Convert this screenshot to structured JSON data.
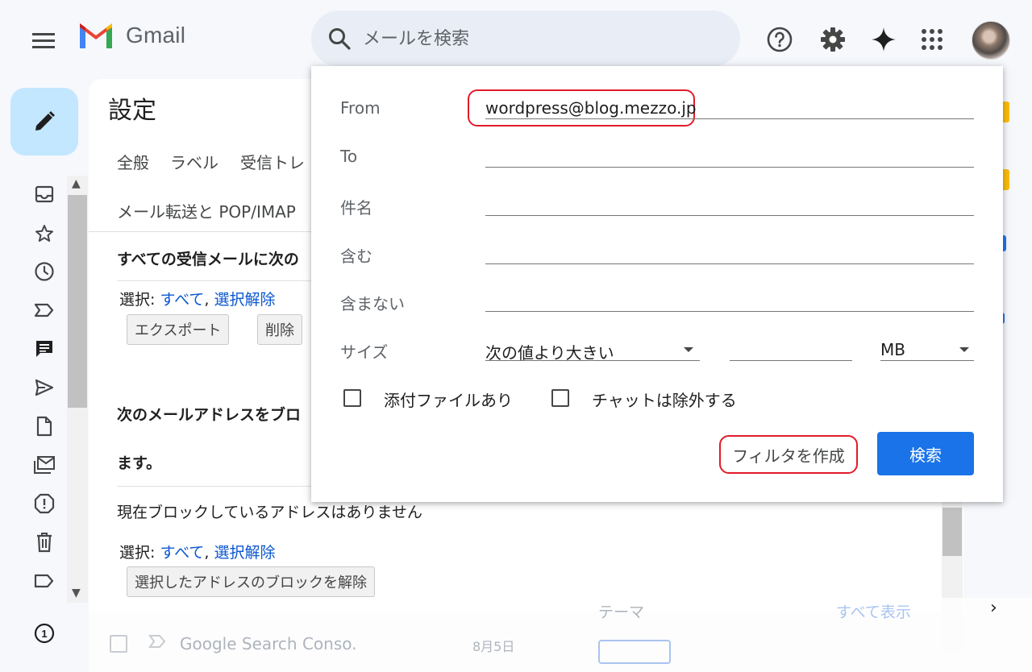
{
  "header": {
    "app_name": "Gmail",
    "search_placeholder": "メールを検索"
  },
  "settings": {
    "title": "設定",
    "tabs_row1": [
      "全般",
      "ラベル",
      "受信トレ"
    ],
    "tabs_row2": [
      "メール転送と POP/IMAP"
    ],
    "section1_heading": "すべての受信メールに次の",
    "select_label": "選択:",
    "select_all": "すべて",
    "select_none": "選択解除",
    "export_button": "エクスポート",
    "delete_button": "削除",
    "section2_heading_line1": "次のメールアドレスをブロ",
    "section2_heading_line2": "ます。",
    "blocked_none": "現在ブロックしているアドレスはありません",
    "unblock_button": "選択したアドレスのブロックを解除"
  },
  "background": {
    "email_sender": "Google Search Conso.",
    "email_date": "8月5日",
    "theme_label": "テーマ",
    "show_all": "すべて表示"
  },
  "search_dialog": {
    "from_label": "From",
    "from_value": "wordpress@blog.mezzo.jp",
    "to_label": "To",
    "subject_label": "件名",
    "has_words_label": "含む",
    "not_has_label": "含まない",
    "size_label": "サイズ",
    "size_operator": "次の値より大きい",
    "size_unit": "MB",
    "has_attachment_label": "添付ファイルあり",
    "exclude_chats_label": "チャットは除外する",
    "create_filter_button": "フィルタを作成",
    "search_button": "検索"
  },
  "colors": {
    "accent": "#1a73e8",
    "highlight_outline": "#e11b2b",
    "compose_bg": "#c2e7ff"
  },
  "rail_icons": [
    "inbox-icon",
    "star-icon",
    "clock-icon",
    "label-important-icon",
    "chat-icon",
    "send-icon",
    "draft-icon",
    "mail-all-icon",
    "spam-icon",
    "trash-icon",
    "label-icon"
  ],
  "rail_badge": "1"
}
